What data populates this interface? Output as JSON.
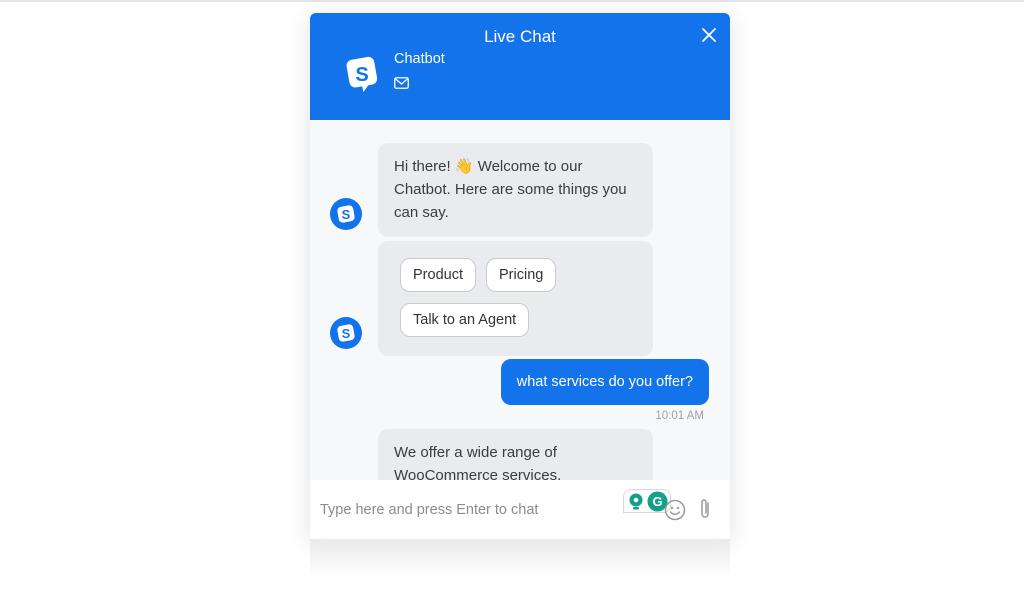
{
  "chat": {
    "title": "Live Chat",
    "bot_name": "Chatbot",
    "icons": {
      "close": "close-icon",
      "logo": "chatbot-logo-icon",
      "mail": "mail-icon",
      "emoji": "emoji-icon",
      "attach": "paperclip-icon",
      "grammarly": "grammarly-icon"
    },
    "colors": {
      "brand": "#1273eb",
      "bot_bubble": "#e9ebee",
      "background": "#f7f8f9"
    }
  },
  "messages": [
    {
      "sender": "bot",
      "text": "Hi there! 👋 Welcome to our Chatbot. Here are some things you can say."
    },
    {
      "sender": "bot",
      "quick_replies": [
        "Product",
        "Pricing",
        "Talk to an Agent"
      ]
    },
    {
      "sender": "user",
      "text": "what services do you offer?",
      "time": "10:01 AM"
    },
    {
      "sender": "bot",
      "text": "We offer a wide range of WooCommerce services."
    }
  ],
  "composer": {
    "placeholder": "Type here and press Enter to chat",
    "value": ""
  }
}
